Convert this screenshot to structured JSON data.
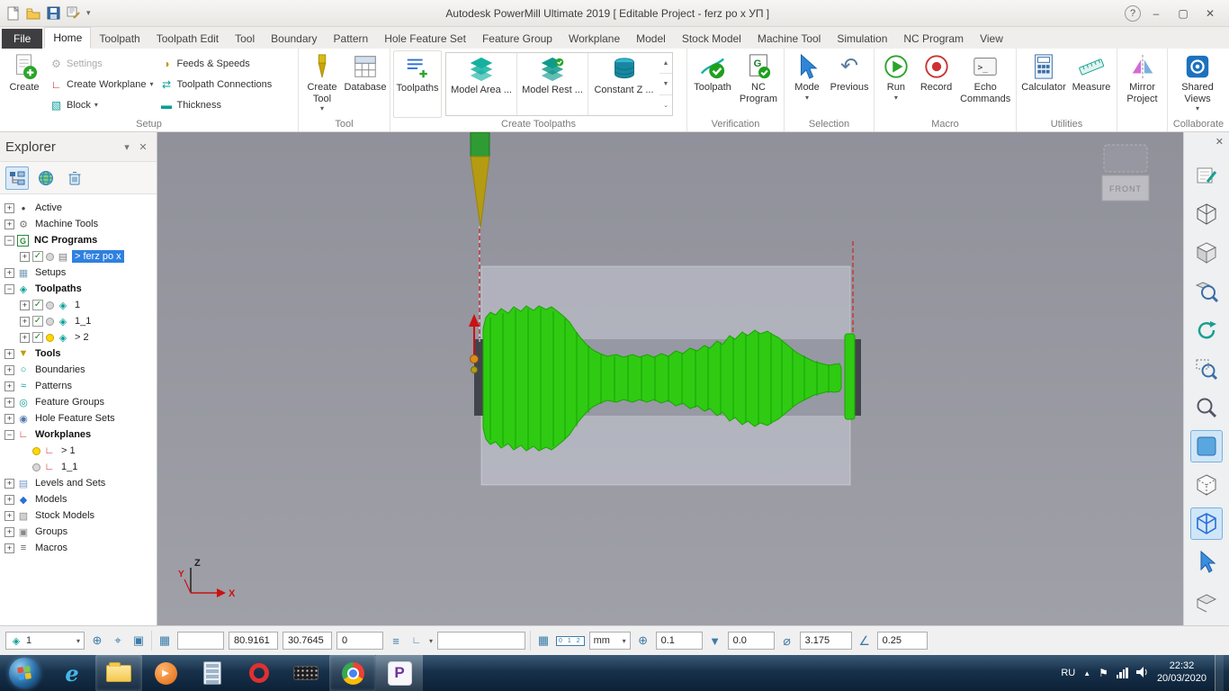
{
  "icons": {
    "dropdown": "▾",
    "close": "✕",
    "minimize": "–",
    "maximize": "▢",
    "help": "?",
    "pin_down": "▼",
    "expand_plus": "+",
    "expand_minus": "−",
    "check": "✓",
    "back": "↶",
    "settings_gear": "⚙",
    "workplane": "∟",
    "block": "▧",
    "feeds": "◑",
    "connections": "⇄",
    "thickness": "▬",
    "position": "⊕",
    "locate": "⌖",
    "frame": "▣",
    "grid": "▦",
    "list": "≡",
    "diameter": "⌀",
    "angle": "∠",
    "tool_tip": "▼",
    "ruler_digits": "0 1 2",
    "tray_flag": "⚑"
  },
  "titlebar": {
    "title": "Autodesk PowerMill Ultimate 2019    [ Editable Project - ferz po x УП ]"
  },
  "tabs": {
    "items": [
      "File",
      "Home",
      "Toolpath",
      "Toolpath Edit",
      "Tool",
      "Boundary",
      "Pattern",
      "Hole Feature Set",
      "Feature Group",
      "Workplane",
      "Model",
      "Stock Model",
      "Machine Tool",
      "Simulation",
      "NC Program",
      "View"
    ]
  },
  "ribbon": {
    "setup": {
      "label": "Setup",
      "create": "Create",
      "settings": "Settings",
      "create_workplane": "Create Workplane",
      "block": "Block",
      "feeds": "Feeds & Speeds",
      "connections": "Toolpath Connections",
      "thickness": "Thickness"
    },
    "tool": {
      "label": "Tool",
      "create_tool": "Create Tool",
      "database": "Database"
    },
    "create_toolpaths": {
      "label": "Create Toolpaths",
      "toolpaths": "Toolpaths",
      "gallery": [
        "Model Area ...",
        "Model Rest ...",
        "Constant Z ..."
      ]
    },
    "verification": {
      "label": "Verification",
      "toolpath": "Toolpath",
      "nc_program": "NC Program"
    },
    "selection": {
      "label": "Selection",
      "mode": "Mode",
      "previous": "Previous"
    },
    "macro": {
      "label": "Macro",
      "run": "Run",
      "record": "Record",
      "echo": "Echo Commands"
    },
    "utilities": {
      "label": "Utilities",
      "calculator": "Calculator",
      "measure": "Measure"
    },
    "mirror": {
      "mirror_project": "Mirror Project"
    },
    "collaborate": {
      "label": "Collaborate",
      "shared_views": "Shared Views"
    }
  },
  "explorer": {
    "title": "Explorer",
    "items": [
      {
        "label": "Active",
        "glyph": "●"
      },
      {
        "label": "Machine Tools",
        "glyph": "⚙"
      },
      {
        "label": "NC Programs",
        "glyph": "G"
      },
      {
        "label": "> ferz po x",
        "glyph": "▤"
      },
      {
        "label": "Setups",
        "glyph": "▦"
      },
      {
        "label": "Toolpaths",
        "glyph": "◈"
      },
      {
        "label": "1",
        "glyph": "◈"
      },
      {
        "label": "1_1",
        "glyph": "◈"
      },
      {
        "label": "> 2",
        "glyph": "◈"
      },
      {
        "label": "Tools",
        "glyph": "▼"
      },
      {
        "label": "Boundaries",
        "glyph": "○"
      },
      {
        "label": "Patterns",
        "glyph": "≈"
      },
      {
        "label": "Feature Groups",
        "glyph": "◎"
      },
      {
        "label": "Hole Feature Sets",
        "glyph": "◉"
      },
      {
        "label": "Workplanes",
        "glyph": "∟"
      },
      {
        "label": "> 1",
        "glyph": "∟"
      },
      {
        "label": "1_1",
        "glyph": "∟"
      },
      {
        "label": "Levels and Sets",
        "glyph": "▤"
      },
      {
        "label": "Models",
        "glyph": "◆"
      },
      {
        "label": "Stock Models",
        "glyph": "▧"
      },
      {
        "label": "Groups",
        "glyph": "▣"
      },
      {
        "label": "Macros",
        "glyph": "≡"
      }
    ]
  },
  "viewport": {
    "viewcube_label": "FRONT",
    "axis_x": "X",
    "axis_y": "Y",
    "axis_z": "Z"
  },
  "statusbar": {
    "tool_number": "1",
    "coord_x": "80.9161",
    "coord_y": "30.7645",
    "coord_z": "0",
    "units": "mm",
    "tolerance": "0.1",
    "thickness": "0.0",
    "diameter": "3.175",
    "tip_radius": "0.25"
  },
  "taskbar": {
    "lang": "RU",
    "time": "22:32",
    "date": "20/03/2020",
    "ie_glyph": "e",
    "opera_glyph": "O",
    "powermill_glyph": "P"
  }
}
